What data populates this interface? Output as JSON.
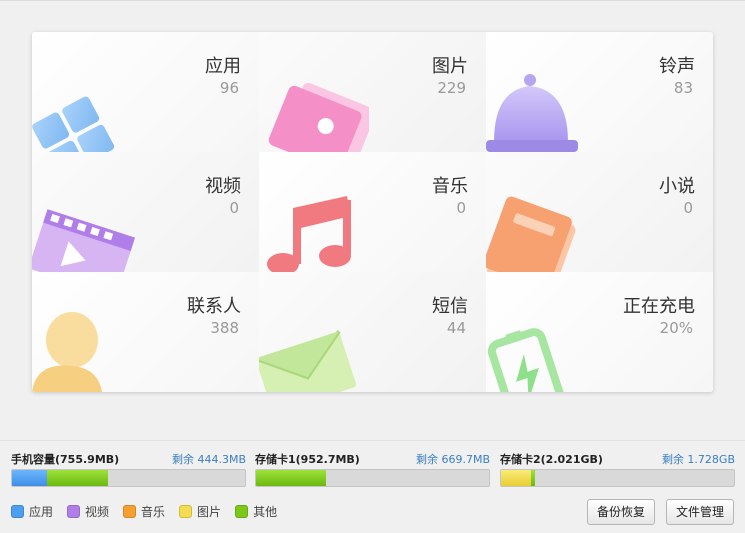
{
  "tiles": [
    {
      "label": "应用",
      "count": "96",
      "icon": "apps-icon",
      "color": "#7fb8f0"
    },
    {
      "label": "图片",
      "count": "229",
      "icon": "picture-icon",
      "color": "#f58fc8"
    },
    {
      "label": "铃声",
      "count": "83",
      "icon": "bell-icon",
      "color": "#b6a6f2"
    },
    {
      "label": "视频",
      "count": "0",
      "icon": "video-icon",
      "color": "#c58ee8"
    },
    {
      "label": "音乐",
      "count": "0",
      "icon": "music-icon",
      "color": "#f07a80"
    },
    {
      "label": "小说",
      "count": "0",
      "icon": "book-icon",
      "color": "#f7a070"
    },
    {
      "label": "联系人",
      "count": "388",
      "icon": "contact-icon",
      "color": "#f6cf80"
    },
    {
      "label": "短信",
      "count": "44",
      "icon": "message-icon",
      "color": "#b5e08a"
    },
    {
      "label": "正在充电",
      "count": "20%",
      "icon": "battery-icon",
      "color": "#8fe08a"
    }
  ],
  "storage": [
    {
      "title": "手机容量(755.9MB)",
      "free": "剩余 444.3MB",
      "segments": [
        {
          "type": "应用",
          "fraction": 0.15
        },
        {
          "type": "其他",
          "fraction": 0.26
        }
      ]
    },
    {
      "title": "存储卡1(952.7MB)",
      "free": "剩余 669.7MB",
      "segments": [
        {
          "type": "其他",
          "fraction": 0.3
        }
      ]
    },
    {
      "title": "存储卡2(2.021GB)",
      "free": "剩余 1.728GB",
      "segments": [
        {
          "type": "图片",
          "fraction": 0.13
        },
        {
          "type": "其他",
          "fraction": 0.015
        }
      ]
    }
  ],
  "legend": [
    {
      "label": "应用",
      "color": "#4a9ff0"
    },
    {
      "label": "视频",
      "color": "#b07ee8"
    },
    {
      "label": "音乐",
      "color": "#f5a030"
    },
    {
      "label": "图片",
      "color": "#f3dc50"
    },
    {
      "label": "其他",
      "color": "#7cc818"
    }
  ],
  "buttons": {
    "backup": "备份恢复",
    "files": "文件管理"
  }
}
